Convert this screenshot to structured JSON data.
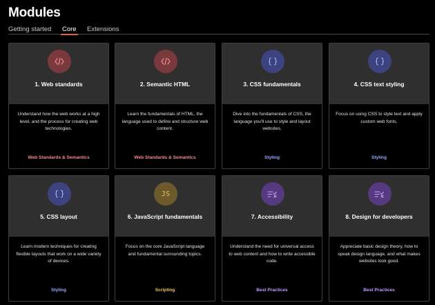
{
  "page": {
    "title": "Modules"
  },
  "tabs": [
    {
      "label": "Getting started",
      "active": false
    },
    {
      "label": "Core",
      "active": true
    },
    {
      "label": "Extensions",
      "active": false
    }
  ],
  "colors": {
    "tab_active_underline": "#e2603a",
    "web_icon_bg": "#7a3a3d",
    "web_icon_fg": "#f28c8c",
    "css_icon_bg": "#3d437e",
    "css_icon_fg": "#9fb4ff",
    "js_icon_bg": "#6d5a2c",
    "js_icon_fg": "#e8c269",
    "practices_icon_bg": "#56397e",
    "practices_icon_fg": "#c6a2ff",
    "tag_web": "#f28c8c",
    "tag_styling": "#97a9ff",
    "tag_scripting": "#efc46b",
    "tag_practices": "#c69cff"
  },
  "cards": [
    {
      "title": "1. Web standards",
      "description": "Understand how the web works at a high level, and the process for creating web technologies.",
      "tag": "Web Standards & Semantics",
      "icon": "code-icon"
    },
    {
      "title": "2. Semantic HTML",
      "description": "Learn the fundamentals of HTML, the language used to define and structure web content.",
      "tag": "Web Standards & Semantics",
      "icon": "code-icon"
    },
    {
      "title": "3. CSS fundamentals",
      "description": "Dive into the fundamentals of CSS, the language you'll use to style and layout websites.",
      "tag": "Styling",
      "icon": "braces-icon"
    },
    {
      "title": "4. CSS text styling",
      "description": "Focus on using CSS to style text and apply custom web fonts.",
      "tag": "Styling",
      "icon": "braces-icon"
    },
    {
      "title": "5. CSS layout",
      "description": "Learn modern techniques for creating flexible layouts that work on a wide variety of devices.",
      "tag": "Styling",
      "icon": "braces-icon"
    },
    {
      "title": "6. JavaScript fundamentals",
      "description": "Focus on the core JavaScript language and fundamental surrounding topics.",
      "tag": "Scripting",
      "icon": "js-icon",
      "icon_text": "JS"
    },
    {
      "title": "7. Accessibility",
      "description": "Understand the need for universal access to web content and how to write accessible code.",
      "tag": "Best Practices",
      "icon": "checklist-icon"
    },
    {
      "title": "8. Design for developers",
      "description": "Appreciate basic design theory, how to speak design language, and what makes websites look good.",
      "tag": "Best Practices",
      "icon": "checklist-icon"
    }
  ]
}
